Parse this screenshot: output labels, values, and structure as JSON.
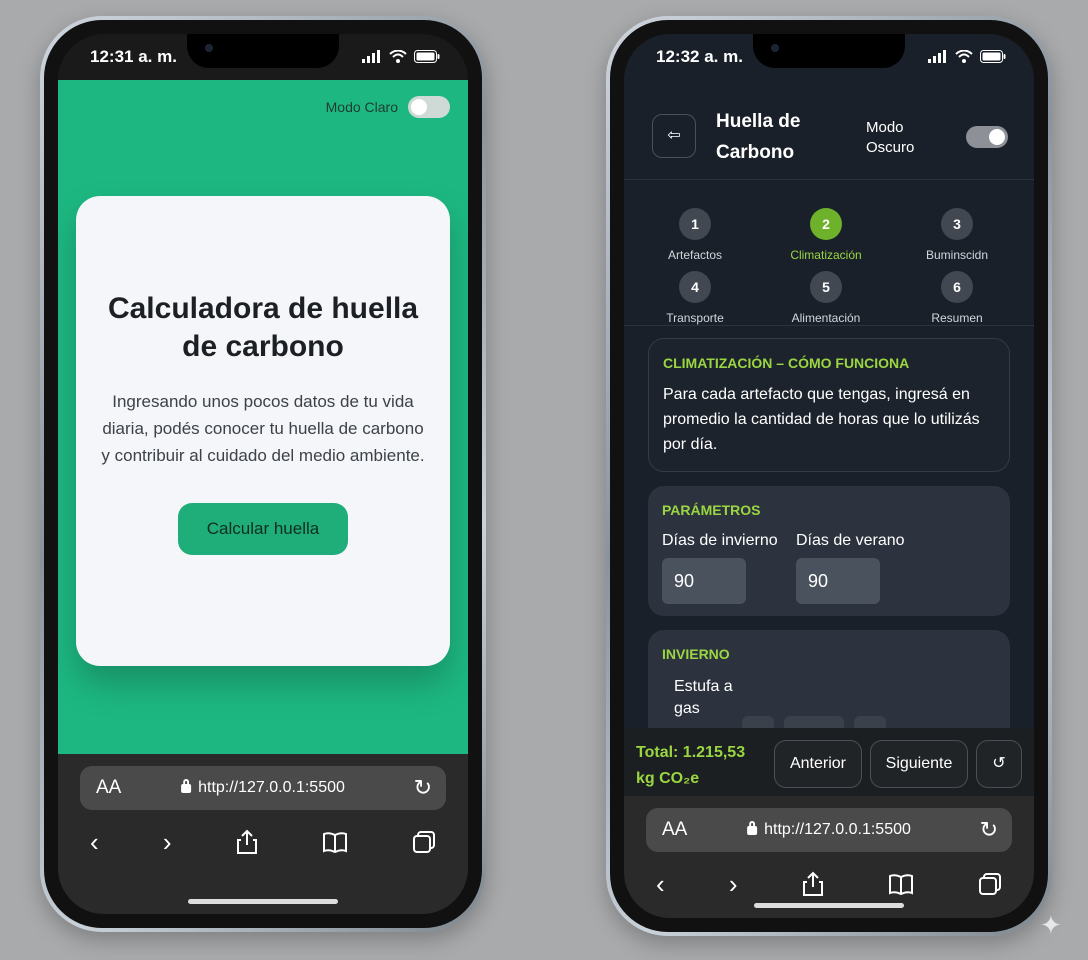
{
  "left_phone": {
    "status_time": "12:31 a. m.",
    "mode_label": "Modo Claro",
    "card_title": "Calculadora de huella de carbono",
    "card_text": "Ingresando unos pocos datos de tu vida diaria, podés conocer tu huella de carbono y contribuir al cuidado del medio ambiente.",
    "cta_label": "Calcular huella",
    "url": "http://127.0.0.1:5500",
    "aa_label": "AA"
  },
  "right_phone": {
    "status_time": "12:32 a. m.",
    "app_title": "Huella de Carbono",
    "mode_label": "Modo Oscuro",
    "steps": [
      {
        "num": "1",
        "label": "Artefactos"
      },
      {
        "num": "2",
        "label": "Climatización"
      },
      {
        "num": "3",
        "label": "Buminscidn"
      },
      {
        "num": "4",
        "label": "Transporte"
      },
      {
        "num": "5",
        "label": "Alimentación"
      },
      {
        "num": "6",
        "label": "Resumen"
      }
    ],
    "active_step": 2,
    "info_title": "CLIMATIZACIÓN – CÓMO FUNCIONA",
    "info_text": "Para cada artefacto que tengas, ingresá en promedio la cantidad de horas que lo utilizás por día.",
    "params_title": "PARÁMETROS",
    "winter_days_label": "Días de invierno",
    "winter_days_value": "90",
    "summer_days_label": "Días de verano",
    "summer_days_value": "90",
    "winter_title": "INVIERNO",
    "winter_item": "Estufa a gas",
    "total_line1": "Total: 1.215,53",
    "total_line2": "kg CO₂e",
    "prev_label": "Anterior",
    "next_label": "Siguiente",
    "reset_label": "↺",
    "url": "http://127.0.0.1:5500",
    "aa_label": "AA"
  },
  "colors": {
    "green": "#1db882",
    "accent_lime": "#9ad641",
    "dark_bg": "#1a2029"
  }
}
